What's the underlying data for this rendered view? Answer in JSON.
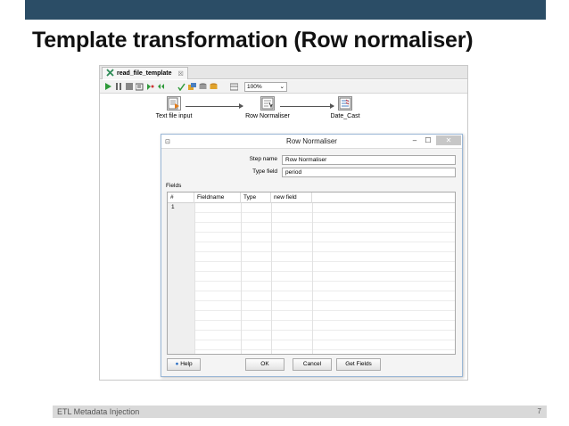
{
  "slide": {
    "title": "Template transformation (Row normaliser)",
    "footer_text": "ETL Metadata Injection",
    "page_number": "7"
  },
  "editor": {
    "tab_label": "read_file_template",
    "zoom": "100%",
    "steps": [
      {
        "label": "Text file input",
        "icon": "text-file-input-icon"
      },
      {
        "label": "Row Normaliser",
        "icon": "row-normaliser-icon"
      },
      {
        "label": "Date_Cast",
        "icon": "select-values-icon"
      }
    ]
  },
  "dialog": {
    "title": "Row Normaliser",
    "step_name_label": "Step name",
    "step_name_value": "Row Normaliser",
    "type_field_label": "Type field",
    "type_field_value": "period",
    "fields_label": "Fields",
    "columns": [
      "#",
      "Fieldname",
      "Type",
      "new field"
    ],
    "rows": [
      "1"
    ],
    "buttons": {
      "help": "Help",
      "ok": "OK",
      "cancel": "Cancel",
      "get_fields": "Get Fields"
    }
  },
  "colors": {
    "top_bar": "#2b4d66",
    "footer_bar": "#d9d9d9"
  }
}
